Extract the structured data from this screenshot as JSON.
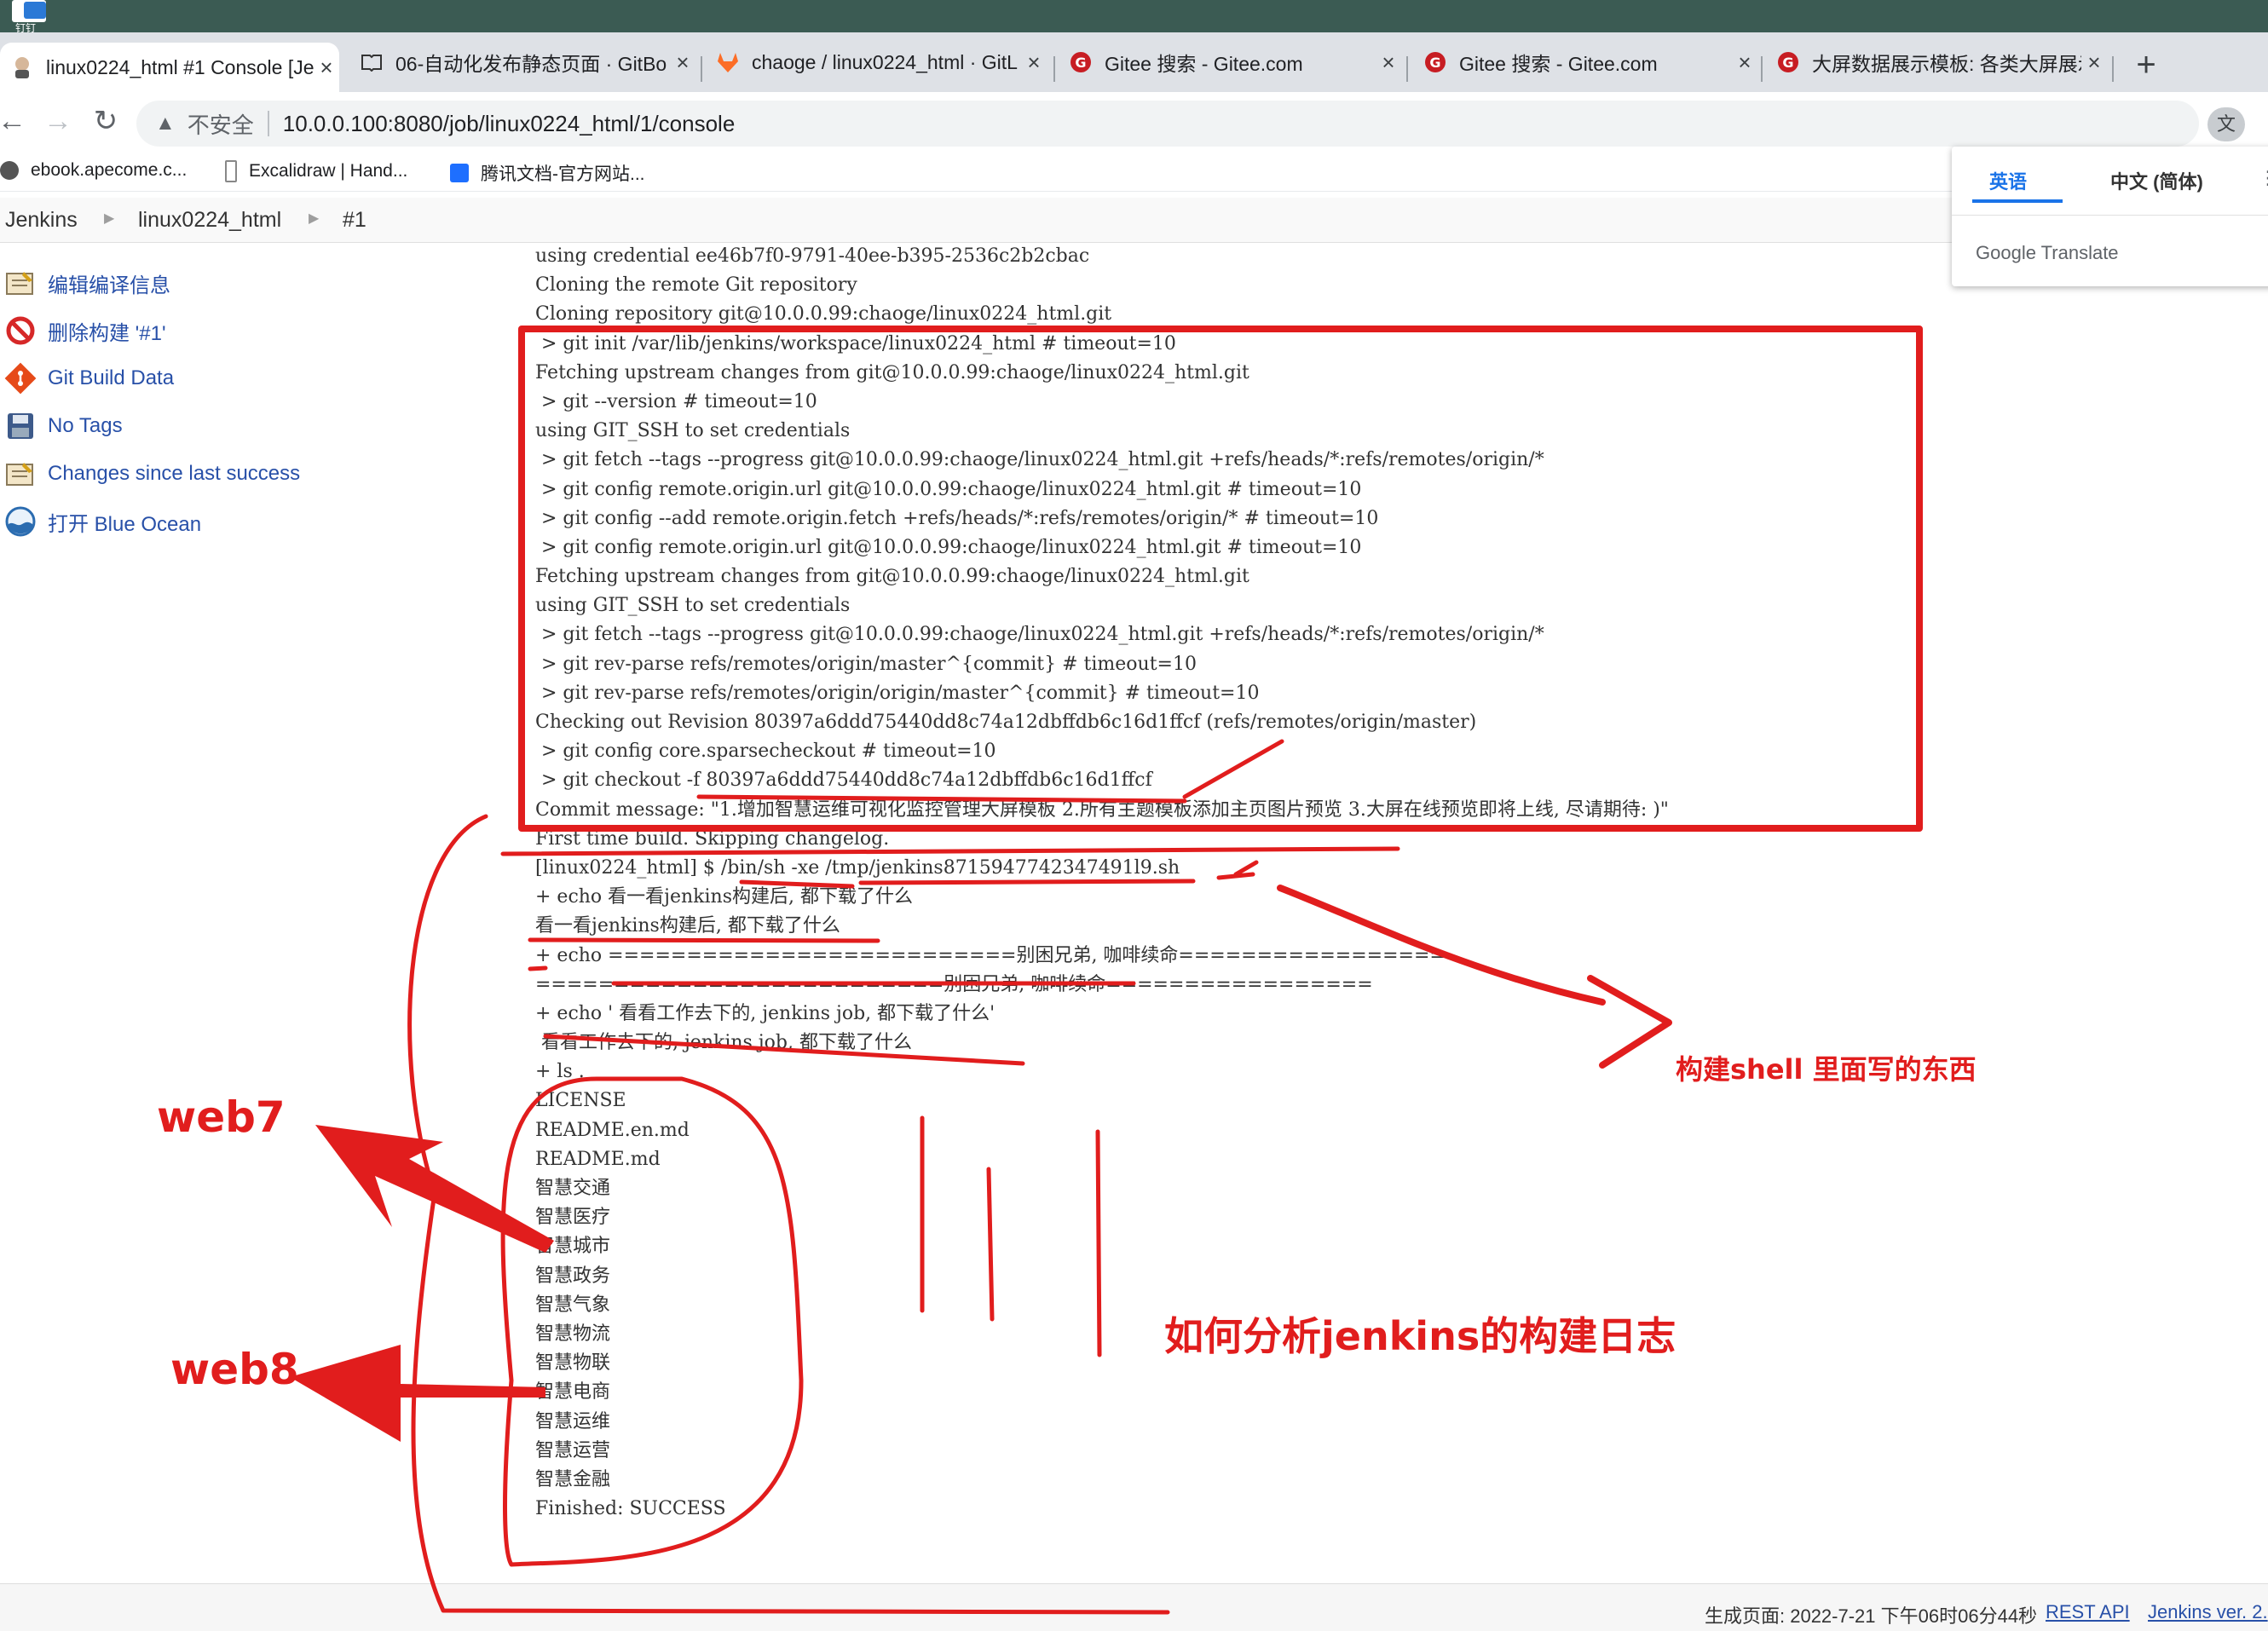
{
  "desktop": {
    "icon_label": "钉钉"
  },
  "tabs": [
    {
      "title": "linux0224_html #1 Console [Je",
      "active": true
    },
    {
      "title": "06-自动化发布静态页面 · GitBo"
    },
    {
      "title": "chaoge / linux0224_html · GitL"
    },
    {
      "title": "Gitee 搜索 - Gitee.com"
    },
    {
      "title": "Gitee 搜索 - Gitee.com"
    },
    {
      "title": "大屏数据展示模板: 各类大屏展示"
    }
  ],
  "toolbar": {
    "security_label": "不安全",
    "url": "10.0.0.100:8080/job/linux0224_html/1/console"
  },
  "bookmarks": [
    "ebook.apecome.c...",
    "Excalidraw | Hand...",
    "腾讯文档-官方网站..."
  ],
  "breadcrumb": [
    "Jenkins",
    "linux0224_html",
    "#1"
  ],
  "side_panel": [
    {
      "label": "编辑编译信息",
      "icon": "notepad-icon"
    },
    {
      "label": "删除构建 '#1'",
      "icon": "no-entry-icon"
    },
    {
      "label": "Git Build Data",
      "icon": "git-icon"
    },
    {
      "label": "No Tags",
      "icon": "save-disk-icon"
    },
    {
      "label": "Changes since last success",
      "icon": "notepad-icon"
    },
    {
      "label": "打开 Blue Ocean",
      "icon": "blue-ocean-icon"
    }
  ],
  "console_lines": [
    "using credential ee46b7f0-9791-40ee-b395-2536c2b2cbac",
    "Cloning the remote Git repository",
    "Cloning repository git@10.0.0.99:chaoge/linux0224_html.git",
    " > git init /var/lib/jenkins/workspace/linux0224_html # timeout=10",
    "Fetching upstream changes from git@10.0.0.99:chaoge/linux0224_html.git",
    " > git --version # timeout=10",
    "using GIT_SSH to set credentials",
    " > git fetch --tags --progress git@10.0.0.99:chaoge/linux0224_html.git +refs/heads/*:refs/remotes/origin/*",
    " > git config remote.origin.url git@10.0.0.99:chaoge/linux0224_html.git # timeout=10",
    " > git config --add remote.origin.fetch +refs/heads/*:refs/remotes/origin/* # timeout=10",
    " > git config remote.origin.url git@10.0.0.99:chaoge/linux0224_html.git # timeout=10",
    "Fetching upstream changes from git@10.0.0.99:chaoge/linux0224_html.git",
    "using GIT_SSH to set credentials",
    " > git fetch --tags --progress git@10.0.0.99:chaoge/linux0224_html.git +refs/heads/*:refs/remotes/origin/*",
    " > git rev-parse refs/remotes/origin/master^{commit} # timeout=10",
    " > git rev-parse refs/remotes/origin/origin/master^{commit} # timeout=10",
    "Checking out Revision 80397a6ddd75440dd8c74a12dbffdb6c16d1ffcf (refs/remotes/origin/master)",
    " > git config core.sparsecheckout # timeout=10",
    " > git checkout -f 80397a6ddd75440dd8c74a12dbffdb6c16d1ffcf",
    "Commit message: \"1.增加智慧运维可视化监控管理大屏模板 2.所有主题模板添加主页图片预览 3.大屏在线预览即将上线, 尽请期待: )\"",
    "First time build. Skipping changelog.",
    "[linux0224_html] $ /bin/sh -xe /tmp/jenkins8715947742347491l9.sh",
    "+ echo 看一看jenkins构建后, 都下载了什么",
    "看一看jenkins构建后, 都下载了什么",
    "+ echo ==========================别困兄弟, 咖啡续命=================",
    "==========================别困兄弟, 咖啡续命=================",
    "+ echo ' 看看工作去下的, jenkins job, 都下载了什么'",
    " 看看工作去下的, jenkins job, 都下载了什么",
    "+ ls .",
    "LICENSE",
    "README.en.md",
    "README.md",
    "智慧交通",
    "智慧医疗",
    "智慧城市",
    "智慧政务",
    "智慧气象",
    "智慧物流",
    "智慧物联",
    "智慧电商",
    "智慧运维",
    "智慧运营",
    "智慧金融",
    "Finished: SUCCESS"
  ],
  "translate_popup": {
    "tab_english": "英语",
    "tab_chinese": "中文 (简体)",
    "brand": "Google Translate"
  },
  "annotations": {
    "web7": "web7",
    "web8": "web8",
    "shell_note": "构建shell 里面写的东西",
    "title_note": "如何分析jenkins的构建日志"
  },
  "footer": {
    "generated": "生成页面: 2022-7-21 下午06时06分44秒",
    "rest_api": "REST API",
    "jenkins_ver": "Jenkins ver. 2."
  },
  "colors": {
    "annotation_red": "#e11d1d",
    "link_blue": "#2850a8",
    "tab_bg": "#dee1e6"
  }
}
